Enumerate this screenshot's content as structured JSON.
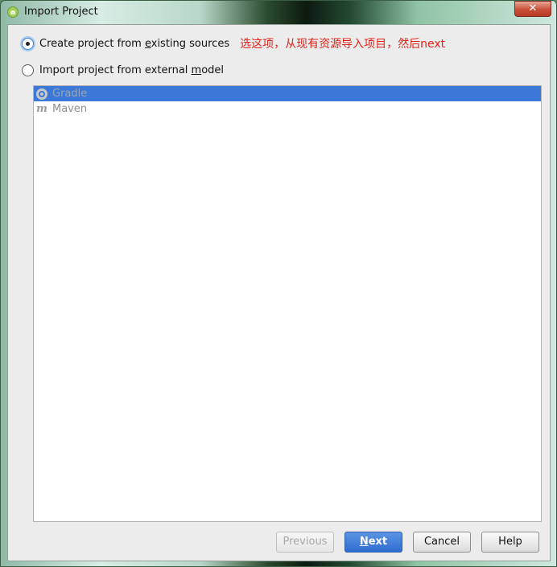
{
  "window": {
    "title": "Import Project",
    "close_glyph": "✕"
  },
  "options": [
    {
      "label_before": "Create project from ",
      "mnemonic": "e",
      "label_after": "xisting sources",
      "checked": true
    },
    {
      "label_before": "Import project from external ",
      "mnemonic": "m",
      "label_after": "odel",
      "checked": false
    }
  ],
  "annotation": "选这项，从现有资源导入项目，然后next",
  "model_list": [
    {
      "label": "Gradle",
      "icon": "gradle-icon",
      "selected": true
    },
    {
      "label": "Maven",
      "icon": "maven-icon",
      "icon_glyph": "m",
      "selected": false
    }
  ],
  "buttons": {
    "previous": "Previous",
    "next_mnemonic": "N",
    "next_rest": "ext",
    "cancel": "Cancel",
    "help": "Help"
  },
  "colors": {
    "selection": "#3c78d8",
    "annotation": "#e2231a",
    "primary_button": "#2f6cd0"
  }
}
